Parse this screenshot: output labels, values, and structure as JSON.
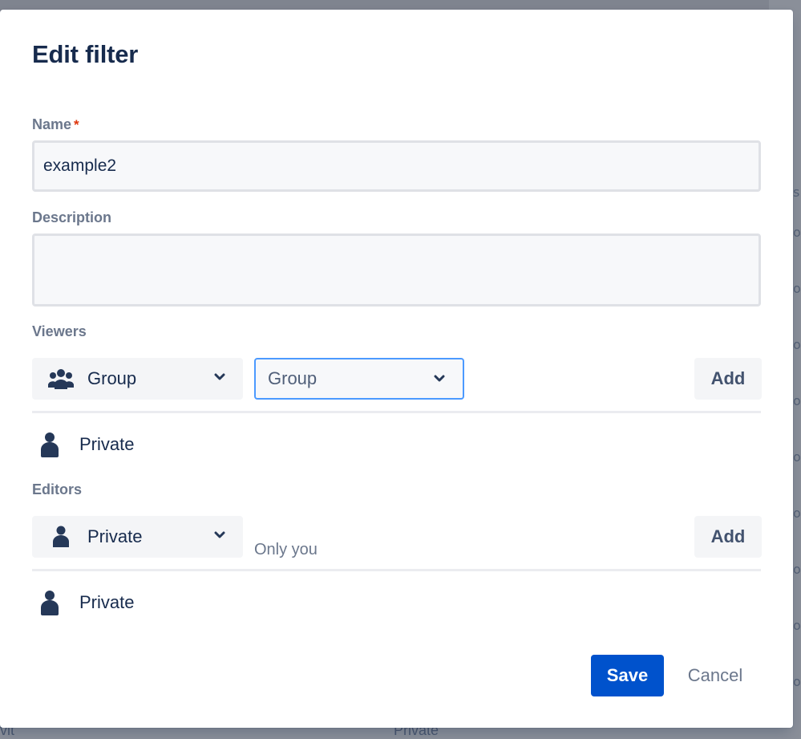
{
  "dialog": {
    "title": "Edit filter"
  },
  "name_field": {
    "label": "Name",
    "required_marker": "*",
    "value": "example2"
  },
  "description_field": {
    "label": "Description",
    "value": ""
  },
  "viewers": {
    "label": "Viewers",
    "type_select": {
      "value": "Group",
      "icon": "group-icon"
    },
    "target_select": {
      "value": "Group"
    },
    "add_label": "Add",
    "entries": [
      {
        "icon": "user-icon",
        "label": "Private"
      }
    ]
  },
  "editors": {
    "label": "Editors",
    "type_select": {
      "value": "Private",
      "icon": "user-icon"
    },
    "hint": "Only you",
    "add_label": "Add",
    "entries": [
      {
        "icon": "user-icon",
        "label": "Private"
      }
    ]
  },
  "footer": {
    "save_label": "Save",
    "cancel_label": "Cancel"
  },
  "background": {
    "partial_text_left": "vit",
    "partial_text_mid": "Private"
  },
  "colors": {
    "primary": "#0052cc",
    "focus_border": "#4c9aff",
    "required": "#de350b",
    "text": "#172b4d",
    "subtle_text": "#6b778c"
  }
}
